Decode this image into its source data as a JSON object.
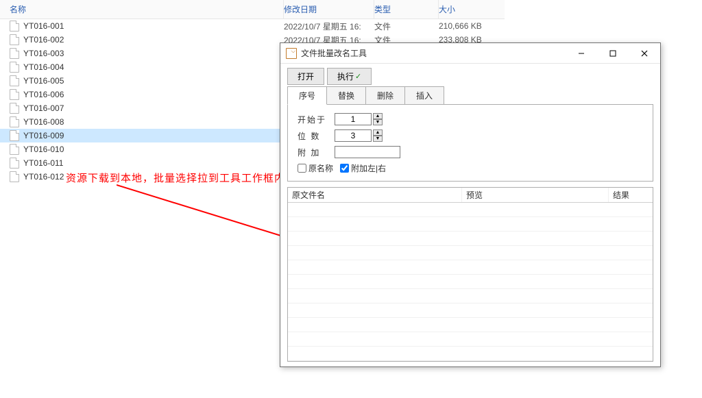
{
  "explorer": {
    "header": {
      "name": "名称",
      "date": "修改日期",
      "type": "类型",
      "size": "大小"
    },
    "rows": [
      {
        "name": "YT016-001",
        "date": "2022/10/7 星期五 16:",
        "type": "文件",
        "size": "210,666 KB"
      },
      {
        "name": "YT016-002",
        "date": "2022/10/7 星期五 16:",
        "type": "文件",
        "size": "233,808 KB"
      },
      {
        "name": "YT016-003",
        "date": "",
        "type": "",
        "size": ""
      },
      {
        "name": "YT016-004",
        "date": "",
        "type": "",
        "size": ""
      },
      {
        "name": "YT016-005",
        "date": "",
        "type": "",
        "size": ""
      },
      {
        "name": "YT016-006",
        "date": "",
        "type": "",
        "size": ""
      },
      {
        "name": "YT016-007",
        "date": "",
        "type": "",
        "size": ""
      },
      {
        "name": "YT016-008",
        "date": "",
        "type": "",
        "size": ""
      },
      {
        "name": "YT016-009",
        "date": "",
        "type": "",
        "size": "",
        "selected": true
      },
      {
        "name": "YT016-010",
        "date": "",
        "type": "",
        "size": ""
      },
      {
        "name": "YT016-011",
        "date": "",
        "type": "",
        "size": ""
      },
      {
        "name": "YT016-012",
        "date": "",
        "type": "",
        "size": ""
      }
    ]
  },
  "annotation": "资源下载到本地，批量选择拉到工具工作框内",
  "window": {
    "title": "文件批量改名工具",
    "buttons": {
      "open": "打开",
      "execute": "执行"
    },
    "tabs": {
      "seq": "序号",
      "replace": "替换",
      "delete": "删除",
      "insert": "插入"
    },
    "form": {
      "start_label": "开始于",
      "start_value": "1",
      "digits_label": "位  数",
      "digits_value": "3",
      "suffix_label": "附  加",
      "suffix_value": "",
      "orig_name": "原名称",
      "append": "附加左|右"
    },
    "grid": {
      "col1": "原文件名",
      "col2": "预览",
      "col3": "结果"
    }
  }
}
